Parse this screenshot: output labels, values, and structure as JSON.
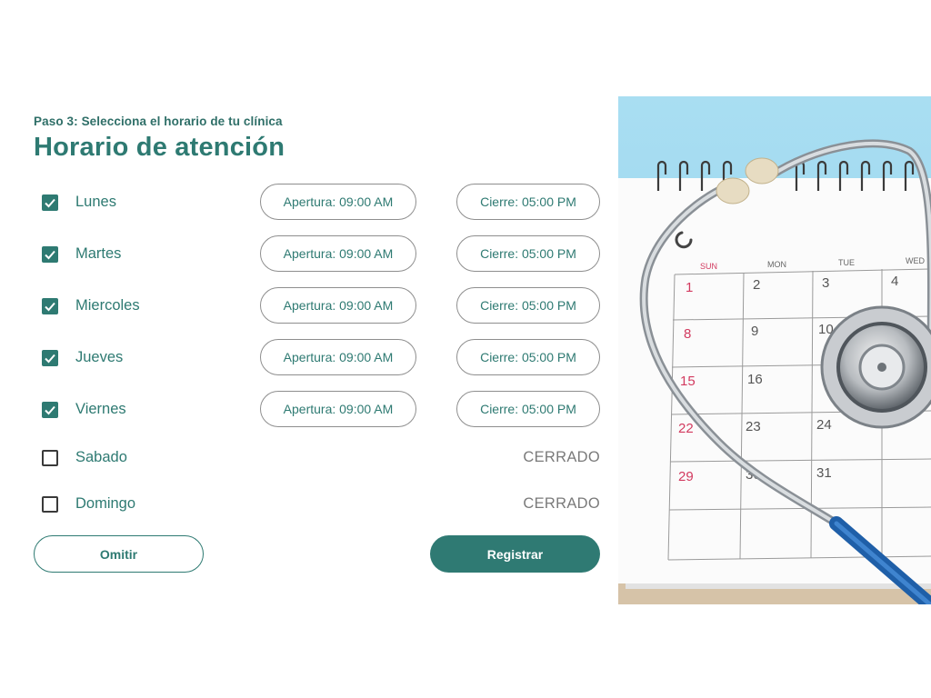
{
  "header": {
    "step": "Paso 3: Selecciona el horario de tu clínica",
    "title": "Horario de atención"
  },
  "schedule": [
    {
      "day": "Lunes",
      "checked": true,
      "open": "Apertura: 09:00 AM",
      "close": "Cierre: 05:00 PM"
    },
    {
      "day": "Martes",
      "checked": true,
      "open": "Apertura: 09:00 AM",
      "close": "Cierre: 05:00 PM"
    },
    {
      "day": "Miercoles",
      "checked": true,
      "open": "Apertura: 09:00 AM",
      "close": "Cierre: 05:00 PM"
    },
    {
      "day": "Jueves",
      "checked": true,
      "open": "Apertura: 09:00 AM",
      "close": "Cierre: 05:00 PM"
    },
    {
      "day": "Viernes",
      "checked": true,
      "open": "Apertura: 09:00 AM",
      "close": "Cierre: 05:00 PM"
    },
    {
      "day": "Sabado",
      "checked": false,
      "status": "CERRADO"
    },
    {
      "day": "Domingo",
      "checked": false,
      "status": "CERRADO"
    }
  ],
  "actions": {
    "skip_label": "Omitir",
    "register_label": "Registrar"
  },
  "calendar_image": {
    "day_headers": [
      "SUN",
      "MON",
      "TUE",
      "WED"
    ],
    "rows": [
      [
        "1",
        "2",
        "3",
        "4"
      ],
      [
        "8",
        "9",
        "10",
        ""
      ],
      [
        "15",
        "16",
        "",
        ""
      ],
      [
        "22",
        "23",
        "24",
        ""
      ],
      [
        "29",
        "30",
        "31",
        ""
      ]
    ]
  },
  "colors": {
    "brand": "#2e7a72",
    "muted": "#7a7a7a",
    "border": "#8e8e8e",
    "sunday_red": "#d23a5f"
  }
}
